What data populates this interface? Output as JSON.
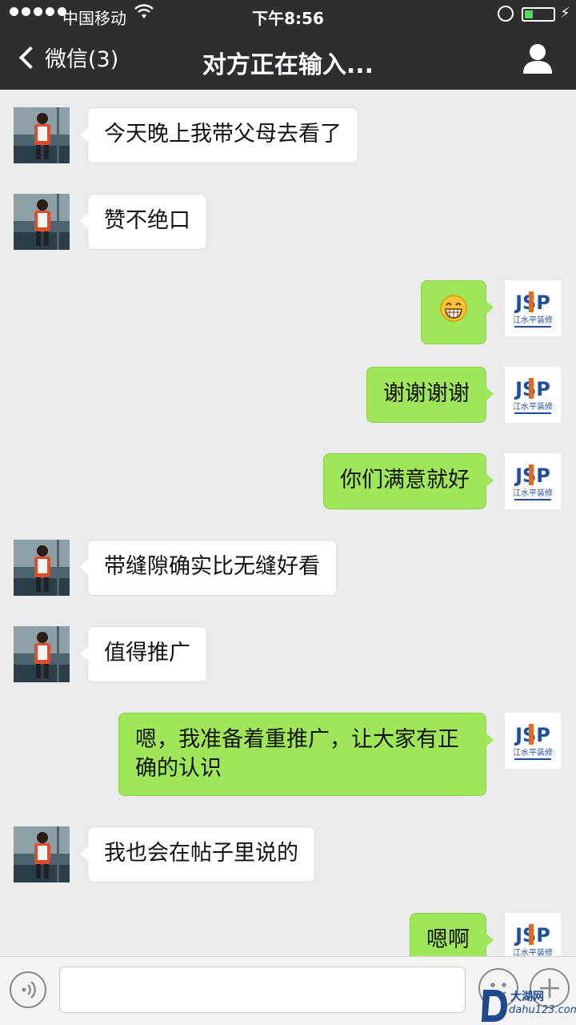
{
  "status_bar": {
    "carrier": "中国移动",
    "time": "下午8:56",
    "battery_level": 0.28
  },
  "header": {
    "back_label": "微信(3)",
    "title": "对方正在输入..."
  },
  "contact_avatar_logo": {
    "mark": "JSP",
    "name": "江水平装修"
  },
  "messages": [
    {
      "side": "left",
      "text": "今天晚上我带父母去看了"
    },
    {
      "side": "left",
      "text": "赞不绝口"
    },
    {
      "side": "right",
      "text": "😁",
      "is_emoji": true
    },
    {
      "side": "right",
      "text": "谢谢谢谢"
    },
    {
      "side": "right",
      "text": "你们满意就好"
    },
    {
      "side": "left",
      "text": "带缝隙确实比无缝好看"
    },
    {
      "side": "left",
      "text": "值得推广"
    },
    {
      "side": "right",
      "text": "嗯，我准备着重推广，让大家有正确的认识"
    },
    {
      "side": "left",
      "text": "我也会在帖子里说的"
    },
    {
      "side": "right",
      "text": "嗯啊"
    }
  ],
  "watermark": {
    "cn": "大湖网",
    "en": "dahu123.com"
  },
  "colors": {
    "bar_bg": "#2e2e32",
    "chat_bg": "#ebebeb",
    "outgoing_bubble": "#9fe658",
    "incoming_bubble": "#ffffff"
  }
}
